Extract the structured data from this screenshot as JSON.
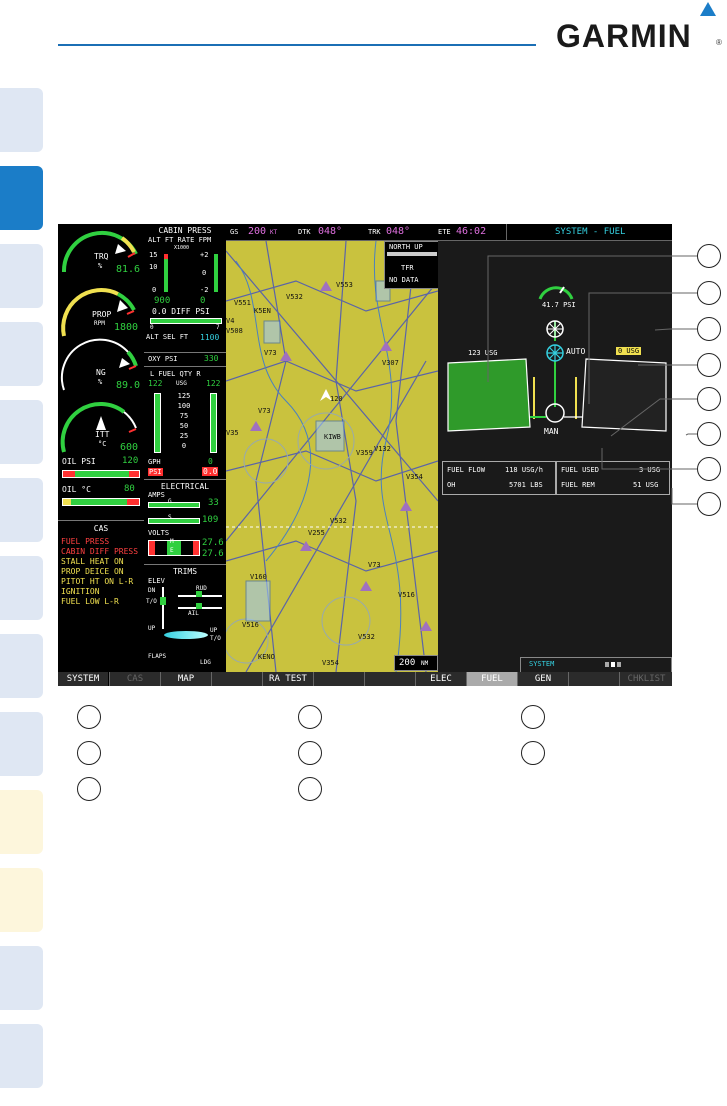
{
  "brand": {
    "logo_text": "GARMIN",
    "registered": "®"
  },
  "top_bar": {
    "gs_label": "GS",
    "gs_value": "200",
    "gs_unit": "KT",
    "dtk_label": "DTK",
    "dtk_value": "048°",
    "trk_label": "TRK",
    "trk_value": "048°",
    "ete_label": "ETE",
    "ete_value": "46:02",
    "page_title": "SYSTEM - FUEL"
  },
  "engine": {
    "trq": {
      "label": "TRQ",
      "unit": "%",
      "value": "81.6"
    },
    "prop": {
      "label": "PROP",
      "unit": "RPM",
      "value": "1800"
    },
    "ng": {
      "label": "NG",
      "unit": "%",
      "value": "89.0"
    },
    "itt": {
      "label": "ITT",
      "unit": "°C",
      "value": "600"
    },
    "oil_psi": {
      "label": "OIL PSI",
      "value": "120"
    },
    "oil_c": {
      "label": "OIL °C",
      "value": "80"
    }
  },
  "cas": {
    "title": "CAS",
    "messages": [
      {
        "text": "FUEL PRESS",
        "color": "#ff4040"
      },
      {
        "text": "CABIN DIFF PRESS",
        "color": "#ff4040"
      },
      {
        "text": "STALL HEAT ON",
        "color": "#f0e050"
      },
      {
        "text": "PROP DEICE ON",
        "color": "#f0e050"
      },
      {
        "text": "PITOT HT ON L-R",
        "color": "#f0e050"
      },
      {
        "text": "IGNITION",
        "color": "#f0e050"
      },
      {
        "text": "FUEL LOW L-R",
        "color": "#f0e050"
      }
    ]
  },
  "cabin": {
    "title": "CABIN PRESS",
    "cols": "ALT FT RATE FPM",
    "x1000": "X1000",
    "alt_ticks": [
      "15",
      "10",
      "0"
    ],
    "rate_ticks": [
      "+2",
      "0",
      "-2"
    ],
    "alt_value": "900",
    "rate_value": "0",
    "diff_label": "0.0 DIFF PSI",
    "diff_ticks": [
      "0",
      "7"
    ],
    "alt_sel_label": "ALT SEL FT",
    "alt_sel_value": "1100",
    "oxy_label": "OXY PSI",
    "oxy_value": "330"
  },
  "fuel_qty": {
    "header": "L  FUEL QTY  R",
    "left_value": "122",
    "unit": "USG",
    "right_value": "122",
    "scale": [
      "125",
      "100",
      "75",
      "50",
      "25",
      "0"
    ],
    "gph_label": "GPH",
    "gph_value": "0",
    "psi_label": "PSI",
    "psi_value": "0.0"
  },
  "electrical": {
    "title": "ELECTRICAL",
    "amps_label": "AMPS",
    "amps_top": "33",
    "amps_bottom": "109",
    "volts_label": "VOLTS",
    "volts_top": "27.6",
    "volts_bottom": "27.6",
    "marker_g": "G",
    "marker_s": "S",
    "marker_m": "M",
    "marker_e": "E"
  },
  "trims": {
    "title": "TRIMS",
    "elev": "ELEV",
    "dn": "DN",
    "to": "T/O",
    "up": "UP",
    "rud": "RUD",
    "ail": "AIL",
    "up2": "UP",
    "to2": "T/O",
    "flaps": "FLAPS",
    "ldg": "LDG"
  },
  "map": {
    "north_up": "NORTH UP",
    "tfr": "TFR",
    "no_data": "NO DATA",
    "range": "200",
    "range_unit": "NM",
    "labels": [
      "V551",
      "V532",
      "V553",
      "V4",
      "V508",
      "K5EN",
      "V73",
      "V307",
      "120",
      "V73",
      "V132",
      "V354",
      "KIWB",
      "V359",
      "V532",
      "V255",
      "V73",
      "V516",
      "V516",
      "V532",
      "KENO",
      "V354",
      "V35",
      "V160"
    ]
  },
  "fuel_sys": {
    "left_qty": "123 USG",
    "right_qty": "0 USG",
    "pressure": "41.7 PSI",
    "auto_label": "AUTO",
    "man_label": "MAN",
    "flow_label": "FUEL FLOW",
    "flow_value": "118 USG/h",
    "oh_label": "OH",
    "oh_value": "5701 LBS",
    "used_label": "FUEL USED",
    "used_value": "3 USG",
    "rem_label": "FUEL REM",
    "rem_value": "51 USG",
    "system_label": "SYSTEM"
  },
  "softkeys": [
    "SYSTEM",
    "CAS",
    "MAP",
    "",
    "RA TEST",
    "",
    "",
    "ELEC",
    "FUEL",
    "GEN",
    "",
    "CHKLIST"
  ],
  "colors": {
    "tab_blue": "#dfe7f3",
    "tab_active": "#1b7dc8",
    "tab_yellow": "#fdf6dc",
    "garmin_blue": "#1b7dc8",
    "map_yellow": "#c9c23e"
  }
}
